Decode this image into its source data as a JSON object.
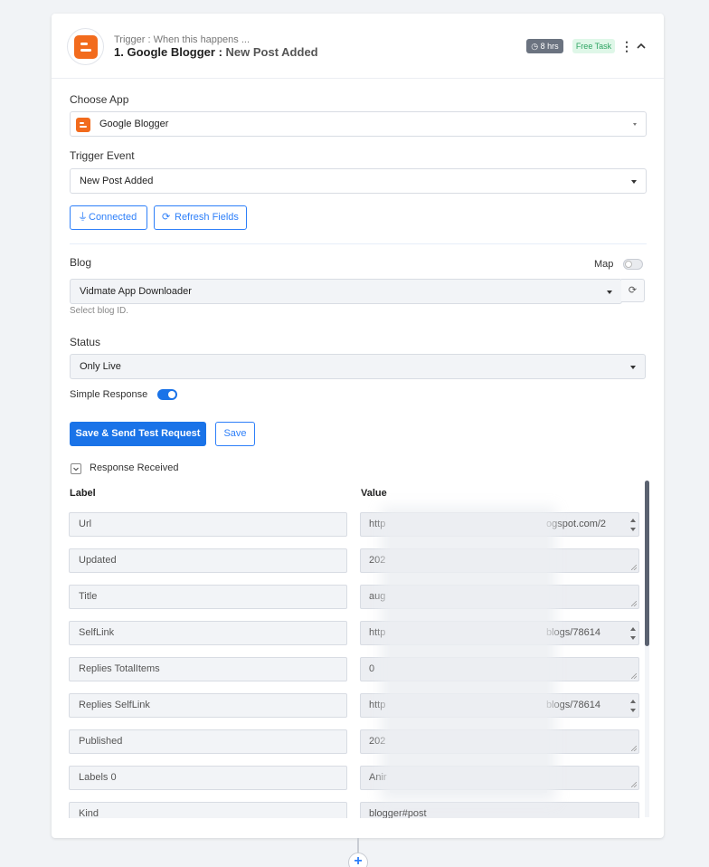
{
  "header": {
    "subtitle": "Trigger : When this happens ...",
    "title_prefix": "1. Google Blogger :",
    "title_event": "New Post Added",
    "time_badge": "8 hrs",
    "task_badge": "Free Task",
    "icons": {
      "app": "blogger-logo",
      "more": "more-vertical-icon",
      "collapse": "chevron-up-icon",
      "clock": "clock-icon"
    },
    "colors": {
      "brand": "#f26b1d",
      "accent": "#1a73e8",
      "free_badge_bg": "#dff7e8",
      "free_badge_text": "#2fa463"
    }
  },
  "choose_app": {
    "label": "Choose App",
    "value": "Google Blogger"
  },
  "trigger_event": {
    "label": "Trigger Event",
    "value": "New Post Added"
  },
  "actions": {
    "connected": "Connected",
    "refresh_fields": "Refresh Fields"
  },
  "blog": {
    "label": "Blog",
    "map_label": "Map",
    "map_enabled": false,
    "value": "Vidmate App Downloader",
    "hint": "Select blog ID."
  },
  "status": {
    "label": "Status",
    "value": "Only Live"
  },
  "simple_response": {
    "label": "Simple Response",
    "enabled": true
  },
  "buttons": {
    "save_send": "Save & Send Test Request",
    "save": "Save"
  },
  "response": {
    "label": "Response Received",
    "col_label": "Label",
    "col_value": "Value",
    "rows": [
      {
        "label": "Url",
        "value": "http",
        "value_tail": "ogspot.com/2"
      },
      {
        "label": "Updated",
        "value": "202",
        "value_tail": ""
      },
      {
        "label": "Title",
        "value": "aug",
        "value_tail": ""
      },
      {
        "label": "SelfLink",
        "value": "http",
        "value_tail": "blogs/78614"
      },
      {
        "label": "Replies TotalItems",
        "value": "0",
        "value_tail": ""
      },
      {
        "label": "Replies SelfLink",
        "value": "http",
        "value_tail": "blogs/78614"
      },
      {
        "label": "Published",
        "value": "202",
        "value_tail": ""
      },
      {
        "label": "Labels 0",
        "value": "Anir",
        "value_tail": ""
      },
      {
        "label": "Kind",
        "value": "blogger#post",
        "value_tail": ""
      }
    ]
  },
  "add_step": "+"
}
